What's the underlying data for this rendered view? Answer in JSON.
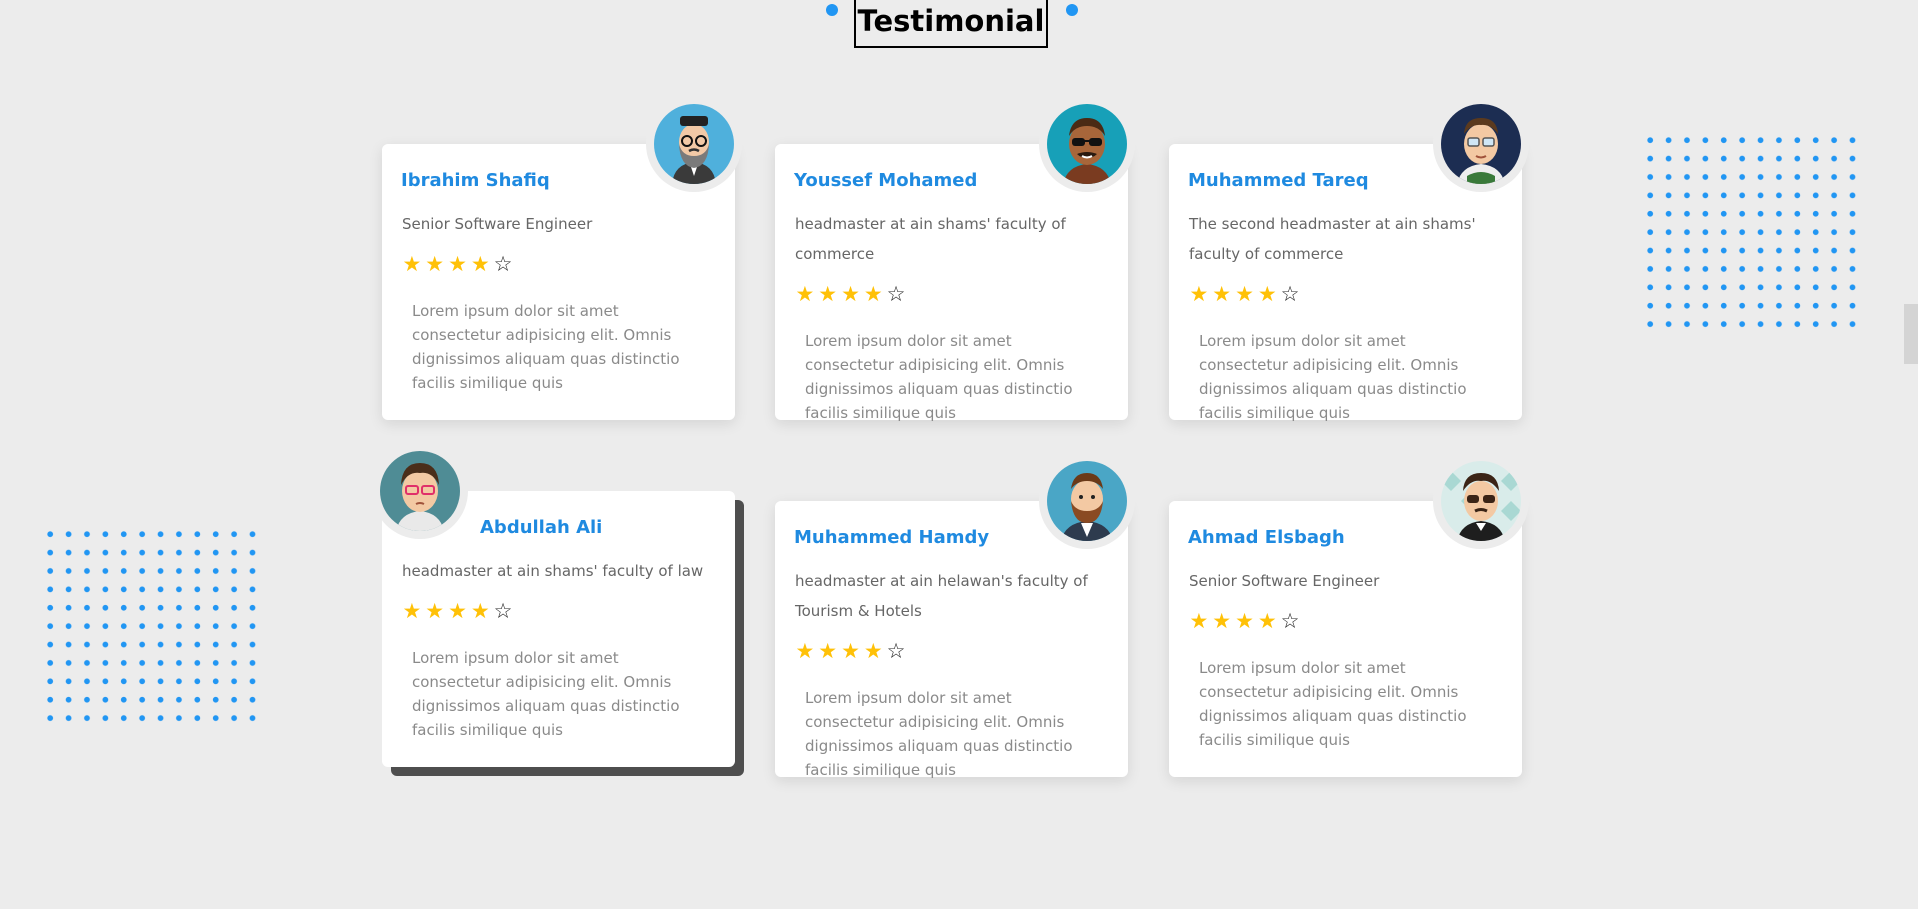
{
  "section": {
    "title": "Testimonial"
  },
  "colors": {
    "accent": "#1f8ae0",
    "dot": "#2196f3",
    "star": "#ffc107"
  },
  "testimonials": [
    {
      "name": "Ibrahim Shafiq",
      "role": "Senior Software Engineer",
      "rating": 4,
      "max_rating": 5,
      "quote": "Lorem ipsum dolor sit amet consectetur adipisicing elit. Omnis dignissimos aliquam quas distinctio facilis similique quis",
      "avatar": "bearded-man-avatar-icon"
    },
    {
      "name": "Youssef Mohamed",
      "role": "headmaster at ain shams' faculty of commerce",
      "rating": 4,
      "max_rating": 5,
      "quote": "Lorem ipsum dolor sit amet consectetur adipisicing elit. Omnis dignissimos aliquam quas distinctio facilis similique quis",
      "avatar": "man-sunglasses-avatar-icon"
    },
    {
      "name": "Muhammed Tareq",
      "role": "The second headmaster at ain shams' faculty of commerce",
      "rating": 4,
      "max_rating": 5,
      "quote": "Lorem ipsum dolor sit amet consectetur adipisicing elit. Omnis dignissimos aliquam quas distinctio facilis similique quis",
      "avatar": "man-glasses-avatar-icon"
    },
    {
      "name": "Abdullah Ali",
      "role": "headmaster at ain shams' faculty of law",
      "rating": 4,
      "max_rating": 5,
      "quote": "Lorem ipsum dolor sit amet consectetur adipisicing elit. Omnis dignissimos aliquam quas distinctio facilis similique quis",
      "avatar": "man-red-glasses-avatar-icon"
    },
    {
      "name": "Muhammed Hamdy",
      "role": "headmaster at ain helawan's faculty of Tourism & Hotels",
      "rating": 4,
      "max_rating": 5,
      "quote": "Lorem ipsum dolor sit amet consectetur adipisicing elit. Omnis dignissimos aliquam quas distinctio facilis similique quis",
      "avatar": "bearded-man-suit-avatar-icon"
    },
    {
      "name": "Ahmad Elsbagh",
      "role": "Senior Software Engineer",
      "rating": 4,
      "max_rating": 5,
      "quote": "Lorem ipsum dolor sit amet consectetur adipisicing elit. Omnis dignissimos aliquam quas distinctio facilis similique quis",
      "avatar": "man-dark-glasses-avatar-icon"
    }
  ]
}
